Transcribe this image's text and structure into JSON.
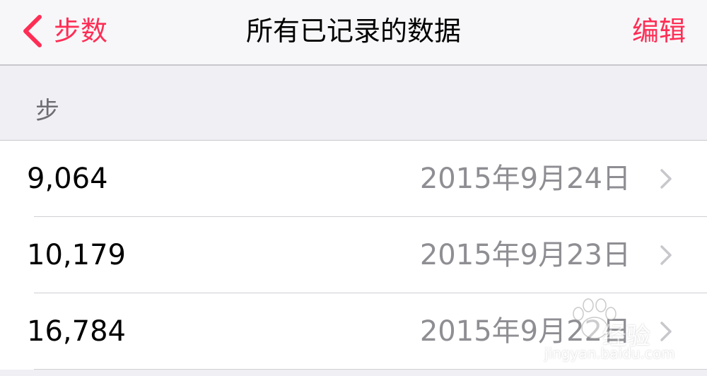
{
  "nav": {
    "back_label": "步数",
    "title": "所有已记录的数据",
    "edit_label": "编辑"
  },
  "section": {
    "title": "步"
  },
  "rows": [
    {
      "value": "9,064",
      "date": "2015年9月24日"
    },
    {
      "value": "10,179",
      "date": "2015年9月23日"
    },
    {
      "value": "16,784",
      "date": "2015年9月22日"
    }
  ],
  "watermark": {
    "brand": "经验",
    "url": "jingyan.baidu.com"
  },
  "colors": {
    "accent": "#ff2d55",
    "secondary_text": "#8e8e93",
    "background": "#efeff4"
  },
  "icons": {
    "back": "chevron-left-icon",
    "disclosure": "chevron-right-icon",
    "watermark": "paw-icon"
  }
}
